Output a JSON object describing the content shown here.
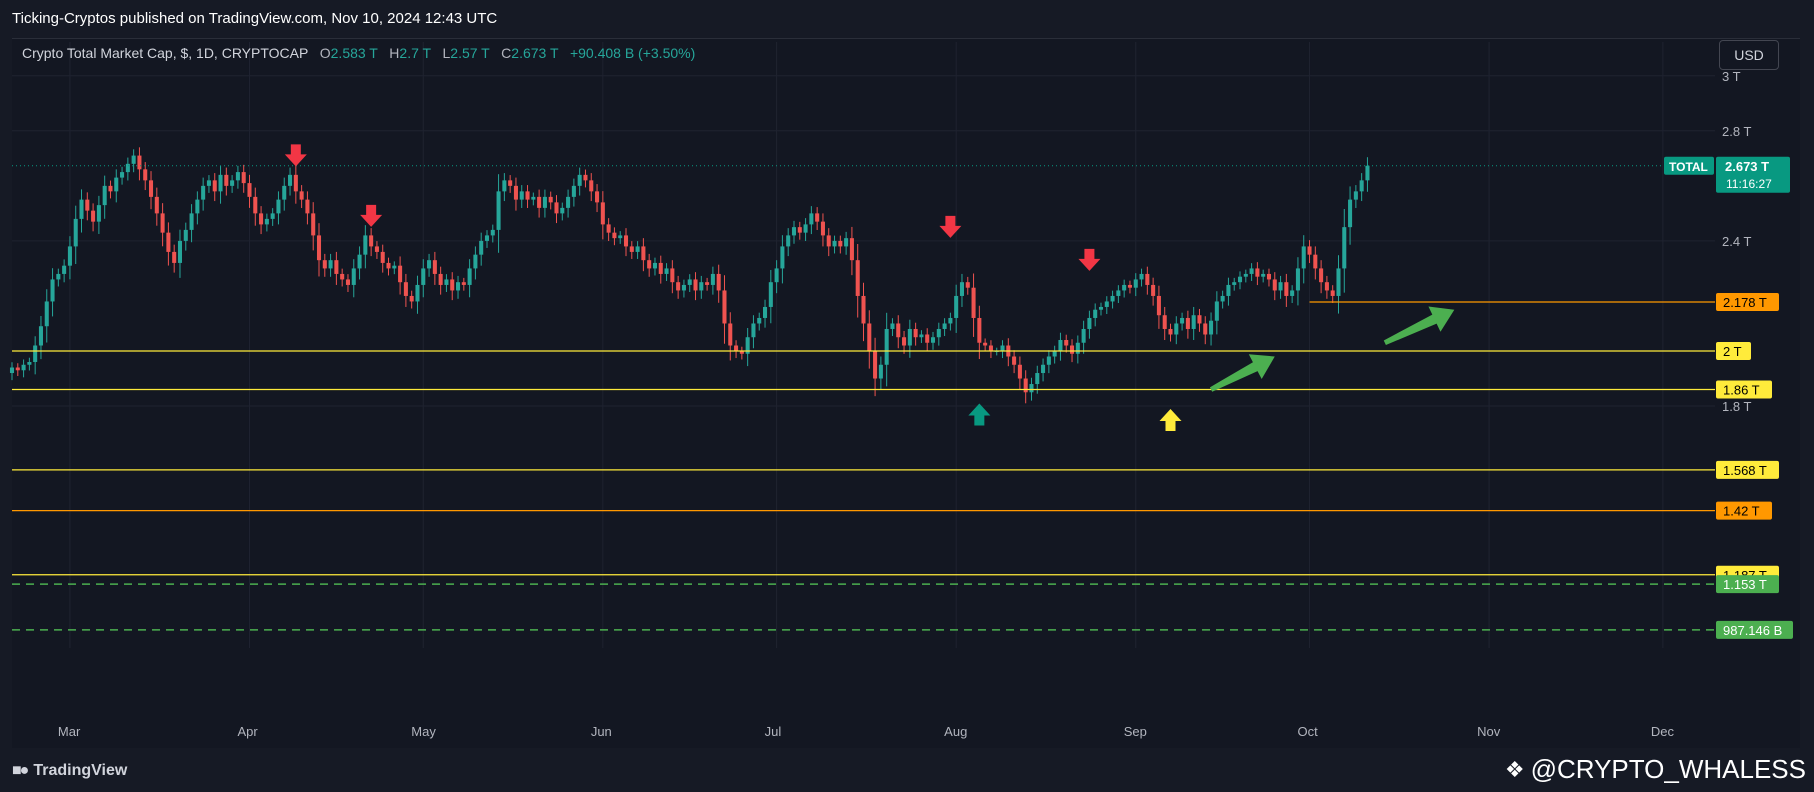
{
  "header": {
    "publish_text": "Ticking-Cryptos published on TradingView.com, Nov 10, 2024 12:43 UTC"
  },
  "legend": {
    "symbol": "Crypto Total Market Cap, $, 1D, CRYPTOCAP",
    "o_label": "O",
    "o_value": "2.583 T",
    "h_label": "H",
    "h_value": "2.7 T",
    "l_label": "L",
    "l_value": "2.57 T",
    "c_label": "C",
    "c_value": "2.673 T",
    "change": "+90.408 B (+3.50%)"
  },
  "currency_button": "USD",
  "footer": {
    "brand": "TradingView",
    "handle": "@CRYPTO_WHALESS"
  },
  "colors": {
    "background": "#131722",
    "up": "#26a69a",
    "down": "#ef5350",
    "yellow_line": "#ffeb3b",
    "orange_line": "#ff9800",
    "green_dash": "#4caf50",
    "price_tag": "#089981"
  },
  "chart_data": {
    "type": "candlestick",
    "title": "Crypto Total Market Cap, $, 1D, CRYPTOCAP",
    "y_axis": {
      "ticks": [
        "3 T",
        "2.8 T",
        "2.4 T",
        "1.8 T"
      ],
      "ylim": [
        0.95,
        3.05
      ],
      "unit": "T"
    },
    "x_axis": {
      "ticks": [
        "Mar",
        "Apr",
        "May",
        "Jun",
        "Jul",
        "Aug",
        "Sep",
        "Oct",
        "Nov",
        "Dec"
      ],
      "range": [
        "2024-02-20",
        "2024-12-10"
      ]
    },
    "last_price": {
      "series": "TOTAL",
      "value": "2.673 T",
      "countdown": "11:16:27"
    },
    "horizontal_levels": [
      {
        "value": 2.178,
        "label": "2.178 T",
        "style": "solid",
        "color": "#ff9800",
        "start": "2024-10-01"
      },
      {
        "value": 2.0,
        "label": "2 T",
        "style": "solid",
        "color": "#ffeb3b",
        "start": "2024-02-20"
      },
      {
        "value": 1.86,
        "label": "1.86 T",
        "style": "solid",
        "color": "#ffeb3b",
        "start": "2024-02-20"
      },
      {
        "value": 1.568,
        "label": "1.568 T",
        "style": "solid",
        "color": "#ffeb3b",
        "start": "2024-02-20"
      },
      {
        "value": 1.42,
        "label": "1.42 T",
        "style": "solid",
        "color": "#ff9800",
        "start": "2024-02-20"
      },
      {
        "value": 1.187,
        "label": "1.187 T",
        "style": "solid",
        "color": "#ffeb3b",
        "start": "2024-02-20"
      },
      {
        "value": 1.153,
        "label": "1.153 T",
        "style": "dashed",
        "color": "#4caf50",
        "start": "2024-02-20"
      },
      {
        "value": 0.987,
        "label": "987.146 B",
        "style": "dashed",
        "color": "#4caf50",
        "start": "2024-02-20"
      }
    ],
    "closes": {
      "start": "2024-02-20",
      "step_days": 1,
      "values": [
        1.94,
        1.93,
        1.95,
        1.96,
        2.02,
        2.09,
        2.18,
        2.26,
        2.28,
        2.31,
        2.38,
        2.48,
        2.55,
        2.51,
        2.47,
        2.53,
        2.6,
        2.58,
        2.63,
        2.65,
        2.68,
        2.71,
        2.66,
        2.62,
        2.56,
        2.5,
        2.43,
        2.36,
        2.32,
        2.4,
        2.44,
        2.5,
        2.55,
        2.6,
        2.62,
        2.58,
        2.64,
        2.6,
        2.62,
        2.65,
        2.61,
        2.56,
        2.5,
        2.46,
        2.48,
        2.5,
        2.55,
        2.6,
        2.64,
        2.58,
        2.55,
        2.5,
        2.42,
        2.33,
        2.3,
        2.33,
        2.28,
        2.26,
        2.24,
        2.3,
        2.35,
        2.42,
        2.38,
        2.36,
        2.32,
        2.3,
        2.31,
        2.25,
        2.2,
        2.18,
        2.24,
        2.3,
        2.33,
        2.28,
        2.24,
        2.26,
        2.22,
        2.25,
        2.24,
        2.3,
        2.35,
        2.4,
        2.42,
        2.44,
        2.58,
        2.62,
        2.6,
        2.55,
        2.58,
        2.55,
        2.56,
        2.52,
        2.56,
        2.54,
        2.5,
        2.52,
        2.56,
        2.6,
        2.64,
        2.62,
        2.58,
        2.54,
        2.46,
        2.43,
        2.41,
        2.42,
        2.38,
        2.36,
        2.38,
        2.33,
        2.3,
        2.32,
        2.28,
        2.3,
        2.25,
        2.22,
        2.24,
        2.26,
        2.22,
        2.25,
        2.24,
        2.28,
        2.22,
        2.1,
        2.02,
        2.0,
        1.99,
        2.05,
        2.1,
        2.12,
        2.16,
        2.25,
        2.3,
        2.38,
        2.42,
        2.45,
        2.43,
        2.46,
        2.5,
        2.47,
        2.42,
        2.38,
        2.4,
        2.38,
        2.41,
        2.33,
        2.2,
        2.1,
        2.0,
        1.9,
        1.95,
        2.08,
        2.1,
        2.05,
        2.02,
        2.08,
        2.05,
        2.06,
        2.03,
        2.05,
        2.08,
        2.1,
        2.12,
        2.2,
        2.25,
        2.23,
        2.12,
        2.03,
        2.02,
        2.0,
        2.0,
        2.02,
        1.98,
        1.95,
        1.9,
        1.85,
        1.88,
        1.92,
        1.95,
        1.98,
        2.0,
        2.04,
        2.02,
        1.99,
        2.03,
        2.08,
        2.12,
        2.15,
        2.16,
        2.18,
        2.2,
        2.22,
        2.24,
        2.23,
        2.26,
        2.28,
        2.24,
        2.2,
        2.13,
        2.08,
        2.06,
        2.1,
        2.12,
        2.08,
        2.13,
        2.1,
        2.06,
        2.11,
        2.18,
        2.2,
        2.24,
        2.25,
        2.27,
        2.28,
        2.3,
        2.27,
        2.28,
        2.26,
        2.22,
        2.25,
        2.2,
        2.22,
        2.3,
        2.38,
        2.35,
        2.3,
        2.25,
        2.22,
        2.2,
        2.3,
        2.45,
        2.55,
        2.58,
        2.62,
        2.673
      ]
    },
    "annotations": [
      {
        "type": "arrow-down",
        "color": "#f23645",
        "date": "2024-04-09",
        "value": 2.7
      },
      {
        "type": "arrow-down",
        "color": "#f23645",
        "date": "2024-04-22",
        "value": 2.48
      },
      {
        "type": "arrow-down",
        "color": "#f23645",
        "date": "2024-07-31",
        "value": 2.44
      },
      {
        "type": "arrow-down",
        "color": "#f23645",
        "date": "2024-08-24",
        "value": 2.32
      },
      {
        "type": "arrow-up",
        "color": "#089981",
        "date": "2024-08-05",
        "value": 1.78
      },
      {
        "type": "arrow-up",
        "color": "#ffeb3b",
        "date": "2024-09-07",
        "value": 1.76
      },
      {
        "type": "arrow-trend",
        "color": "#4caf50",
        "from_date": "2024-09-14",
        "from_value": 1.86,
        "to_date": "2024-09-25",
        "to_value": 1.98
      },
      {
        "type": "arrow-trend",
        "color": "#4caf50",
        "from_date": "2024-10-14",
        "from_value": 2.03,
        "to_date": "2024-10-26",
        "to_value": 2.15
      }
    ]
  }
}
